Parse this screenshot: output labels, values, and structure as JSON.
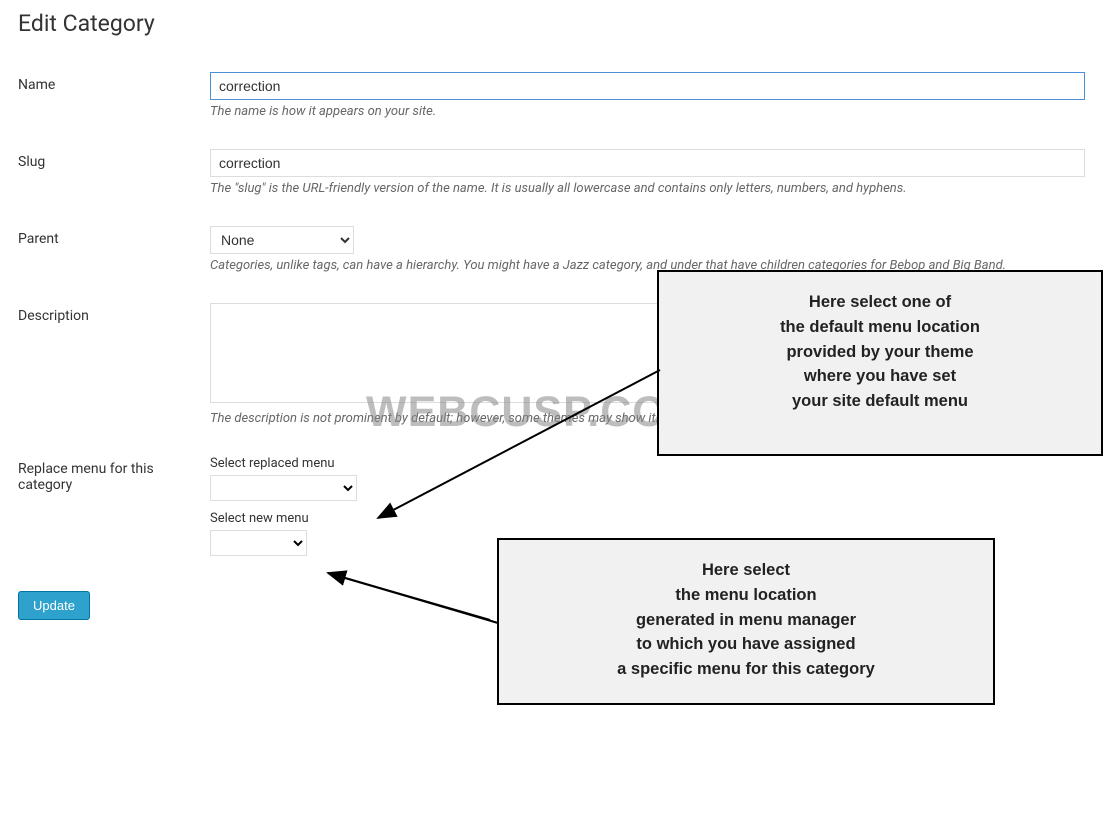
{
  "page_title": "Edit Category",
  "fields": {
    "name": {
      "label": "Name",
      "value": "correction",
      "help": "The name is how it appears on your site."
    },
    "slug": {
      "label": "Slug",
      "value": "correction",
      "help": "The \"slug\" is the URL-friendly version of the name. It is usually all lowercase and contains only letters, numbers, and hyphens."
    },
    "parent": {
      "label": "Parent",
      "value": "None",
      "help": "Categories, unlike tags, can have a hierarchy. You might have a Jazz category, and under that have children categories for Bebop and Big Band."
    },
    "description": {
      "label": "Description",
      "value": "",
      "help": "The description is not prominent by default; however, some themes may show it."
    },
    "replace_menu": {
      "label": "Replace menu for this category",
      "replaced_label": "Select replaced menu",
      "replaced_value": "",
      "new_label": "Select new menu",
      "new_value": ""
    }
  },
  "update_button": "Update",
  "watermark": "WEBCUSP.COM",
  "annotations": {
    "box1": "Here select one of\nthe default menu location\nprovided by your theme\nwhere you have set\nyour site default menu",
    "box2": "Here select\nthe menu location\ngenerated in menu manager\nto which you have assigned\na specific menu for this category"
  }
}
